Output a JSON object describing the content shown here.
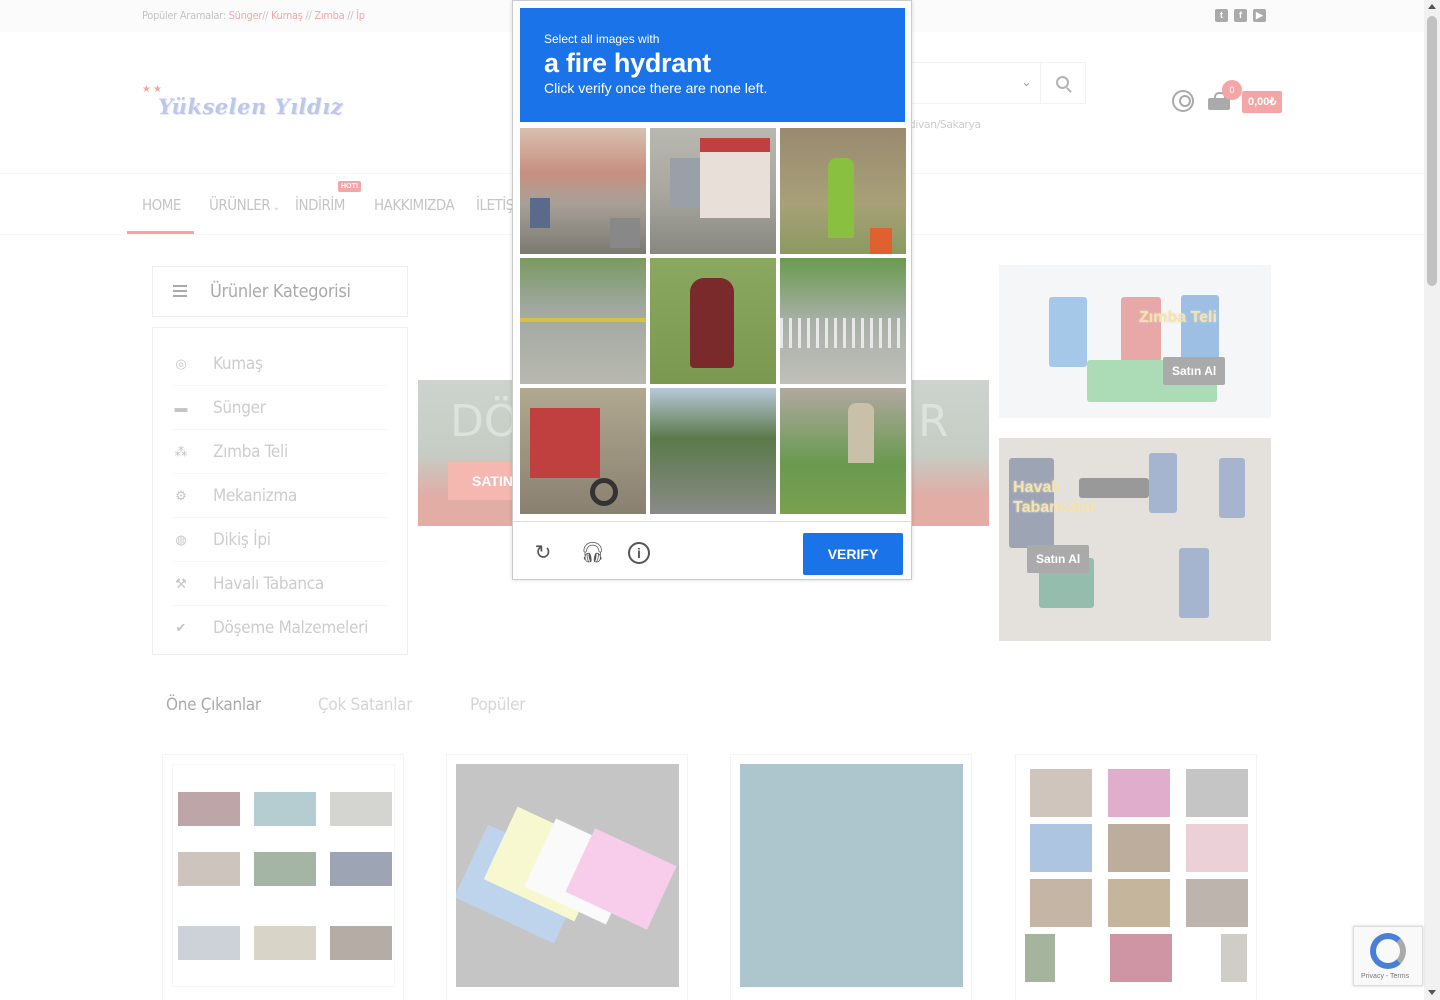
{
  "topbar": {
    "popular_label": "Popüler Aramalar:",
    "popular_links": [
      "Sünger",
      "Kumaş",
      "Zımba",
      "İp"
    ]
  },
  "social_icons": [
    "twitter-icon",
    "facebook-icon",
    "youtube-icon"
  ],
  "header": {
    "logo_text": "Yükselen Yıldız",
    "address_text": "rdivan/Sakarya",
    "cart_count": "0",
    "cart_total": "0,00₺"
  },
  "nav": {
    "items": [
      "HOME",
      "ÜRÜNLER",
      "İNDİRİM",
      "HAKKIMIZDA",
      "İLETİŞ"
    ],
    "hot_badge": "HOT!"
  },
  "sidebar": {
    "title": "Ürünler Kategorisi",
    "items": [
      {
        "label": "Kumaş",
        "icon": "fabric-icon"
      },
      {
        "label": "Sünger",
        "icon": "sofa-icon"
      },
      {
        "label": "Zımba Teli",
        "icon": "staple-icon"
      },
      {
        "label": "Mekanizma",
        "icon": "gear-icon"
      },
      {
        "label": "Dikiş İpi",
        "icon": "thread-icon"
      },
      {
        "label": "Havalı Tabanca",
        "icon": "gun-icon"
      },
      {
        "label": "Döşeme Malzemeleri",
        "icon": "check-icon"
      }
    ]
  },
  "slider": {
    "text_left": "DÖ",
    "text_right": "R",
    "button_label": "SATIN"
  },
  "banners": [
    {
      "title": "Zımba Teli",
      "button": "Satın Al"
    },
    {
      "title": "Havalı Tabancalar",
      "button": "Satın Al"
    }
  ],
  "tabs": [
    "Öne Çıkanlar",
    "Çok Satanlar",
    "Popüler"
  ],
  "captcha": {
    "line1": "Select all images with",
    "target": "a fire hydrant",
    "line3": "Click verify once there are none left.",
    "verify_label": "VERIFY",
    "footer_icons": [
      "reload-icon",
      "headphones-icon",
      "info-icon"
    ]
  },
  "recaptcha_badge": {
    "text": "Privacy - Terms"
  },
  "colors": {
    "accent": "#e84a4a",
    "captcha_blue": "#1a73e8"
  }
}
